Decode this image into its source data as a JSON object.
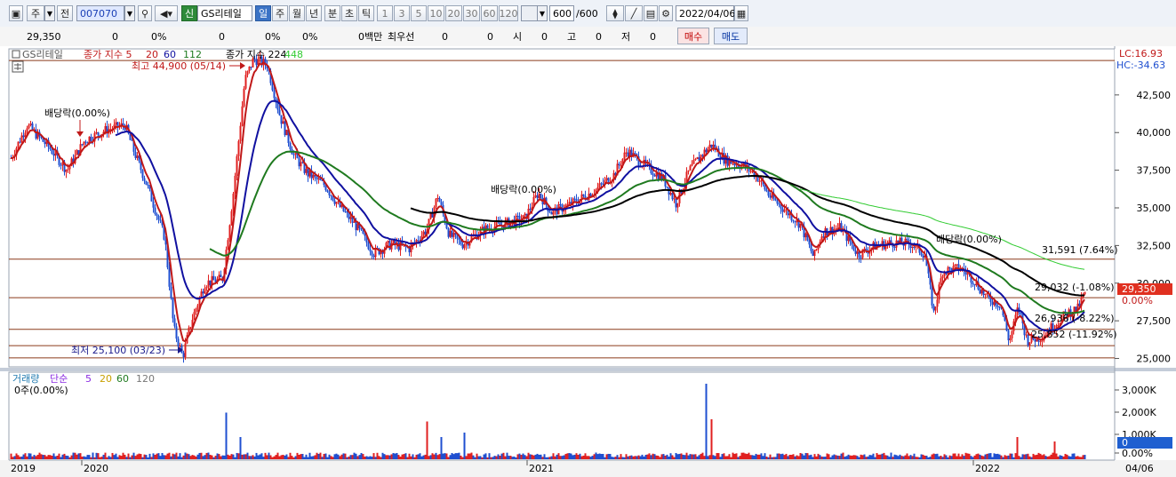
{
  "toolbar": {
    "period": "주",
    "prev": "전",
    "code": "007070",
    "stock_name": "GS리테일",
    "tabs": [
      "일",
      "주",
      "월",
      "년",
      "분",
      "초",
      "틱"
    ],
    "selected_tab": "일",
    "minutes": [
      "1",
      "3",
      "5",
      "10",
      "20",
      "30",
      "60",
      "120"
    ],
    "count": "600",
    "count_total": "/600",
    "date": "2022/04/06",
    "shin": "신"
  },
  "infobar": {
    "price": "29,350",
    "change": "0",
    "change_rate": "0%",
    "volume": "0",
    "vol_rate": "0%",
    "rate2": "0%",
    "amount": "0백만",
    "best_label": "최우선",
    "best_ask": "0",
    "best_bid": "0",
    "open_label": "시",
    "open": "0",
    "high_label": "고",
    "high": "0",
    "low_label": "저",
    "low": "0",
    "buy": "매수",
    "sell": "매도"
  },
  "price_panel": {
    "legend_name": "GS리테일",
    "legend_ma_label": "종가 지수 5",
    "legend_ma_periods": [
      "20",
      "60",
      "112"
    ],
    "legend_ma2_label": "종가 지수 224",
    "legend_ma2_period": "448",
    "lc": "LC:16.93",
    "hc": "HC:-34.63",
    "high_note": "최고 44,900 (05/14)",
    "low_note": "최저 25,100 (03/23)",
    "dividend_1": "배당락(0.00%)",
    "dividend_2": "배당락(0.00%)",
    "dividend_3": "배당락(0.00%)",
    "level_1": "31,591 (7.64%)",
    "level_2": "29,032 (-1.08%)",
    "level_3": "26,936 (-8.22%)",
    "level_4": "25,852 (-11.92%)",
    "current_price": "29,350",
    "current_rate": "0.00%",
    "y_ticks": [
      "42,500",
      "40,000",
      "37,500",
      "35,000",
      "32,500",
      "30,000",
      "27,500",
      "25,000"
    ]
  },
  "volume_panel": {
    "legend_label": "거래량",
    "legend_type": "단순",
    "legend_periods": [
      "5",
      "20",
      "60",
      "120"
    ],
    "info": "0주(0.00%)",
    "y_ticks": [
      "3,000K",
      "2,000K",
      "1,000K",
      "0.00%"
    ],
    "current": "0"
  },
  "x_axis": [
    "2019",
    "2020",
    "2021",
    "2022"
  ],
  "x_axis_right": "04/06",
  "colors": {
    "up": "#e02020",
    "down": "#1f4fd0",
    "ma5": "#c01818",
    "ma20": "#1010a0",
    "ma60": "#1f7a1f",
    "ma112": "#000000",
    "ma224": "#33cc33",
    "level": "#8b3a1a"
  },
  "chart_data": {
    "type": "candlestick",
    "ylim": [
      24500,
      45500
    ],
    "highlights": {
      "high": 44900,
      "low": 25100,
      "current": 29350
    },
    "levels": [
      31591,
      29032,
      26936,
      25852
    ]
  }
}
